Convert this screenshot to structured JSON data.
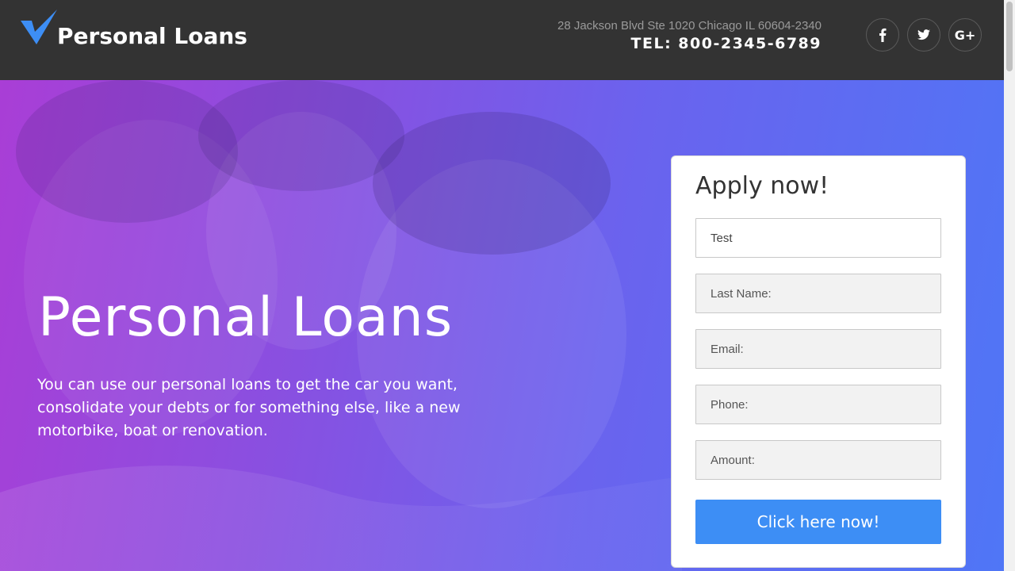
{
  "header": {
    "brand": "Personal Loans",
    "address": "28 Jackson Blvd Ste 1020 Chicago IL 60604-2340",
    "phone": "TEL: 800-2345-6789",
    "socials": [
      {
        "icon": "facebook-icon",
        "glyph": "f"
      },
      {
        "icon": "twitter-icon",
        "glyph": "t"
      },
      {
        "icon": "google-plus-icon",
        "glyph": "G+"
      }
    ]
  },
  "hero": {
    "title": "Personal Loans",
    "text": "You can use our personal loans to get the car you want, consolidate your debts or for something else, like a new motorbike, boat or renovation."
  },
  "form": {
    "title": "Apply now!",
    "first_name_value": "Test",
    "last_name_placeholder": "Last Name:",
    "email_placeholder": "Email:",
    "phone_placeholder": "Phone:",
    "amount_placeholder": "Amount:",
    "submit_label": "Click here now!"
  },
  "colors": {
    "header_bg": "#333333",
    "accent_blue": "#3d8ef5",
    "gradient_start": "#a93ed6",
    "gradient_end": "#4f76f6"
  }
}
